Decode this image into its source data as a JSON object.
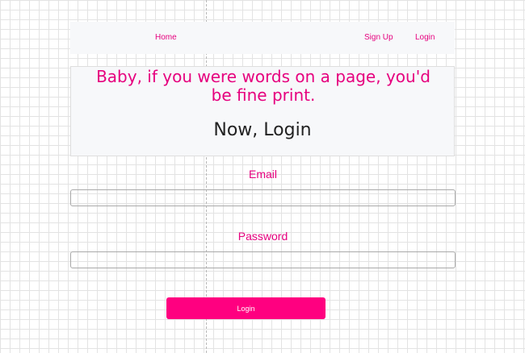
{
  "nav": {
    "home_label": "Home",
    "signup_label": "Sign Up",
    "login_label": "Login"
  },
  "hero": {
    "quote": "Baby, if you were words on a page, you'd be fine print.",
    "title": "Now, Login"
  },
  "form": {
    "email_label": "Email",
    "email_value": "",
    "password_label": "Password",
    "password_value": "",
    "submit_label": "Login"
  },
  "colors": {
    "accent": "#e6007e",
    "button": "#ff0080",
    "panel": "#f7f8fa"
  }
}
